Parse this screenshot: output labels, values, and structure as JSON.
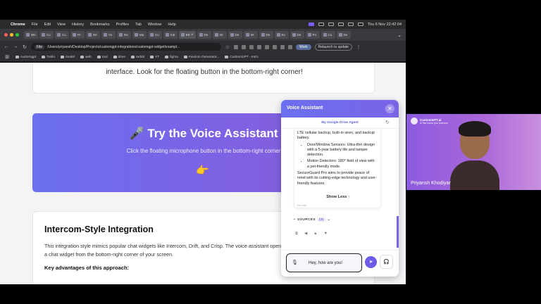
{
  "menubar": {
    "app_name": "Chrome",
    "menus": [
      "File",
      "Edit",
      "View",
      "History",
      "Bookmarks",
      "Profiles",
      "Tab",
      "Window",
      "Help"
    ],
    "clock": "Thu 6 Nov  22:42:04"
  },
  "tabs": [
    "Wo",
    "Co",
    "Cu",
    "Pr",
    "De",
    "Vo",
    "De",
    "Ma",
    "Cu",
    "Inb",
    "Int",
    "De",
    "Int",
    "De",
    "Int",
    "De",
    "Ex",
    "De",
    "Po",
    "Cu",
    "De"
  ],
  "addressbar": {
    "chip": "File",
    "url": "/Users/priyansh/Desktop/Projects/customgpt-integrations/customgpt-widget/exampl...",
    "work_label": "Work",
    "relaunch_label": "Relaunch to update"
  },
  "bookmarks": [
    "customgpt",
    "Trello",
    "model",
    "web",
    "tool",
    "drive",
    "reddit",
    "YT",
    "figma",
    "Favicon Generator...",
    "CustomGPT - Intro"
  ],
  "page": {
    "top_card_text": "interface. Look for the floating button in the bottom-right corner!",
    "hero_title": "🎤 Try the Voice Assistant",
    "hero_subtitle": "Click the floating microphone button in the bottom-right corner",
    "hero_hand": "👉",
    "integration_title": "Intercom-Style Integration",
    "integration_body": "This integration style mimics popular chat widgets like Intercom, Drift, and Crisp. The voice assistant opens a chat widget from the bottom-right corner of your screen.",
    "advantages_label": "Key advantages of this approach:"
  },
  "voice_widget": {
    "title": "Voice Assistant",
    "close_icon": "✕",
    "agent_name": "My Google Drive Agent",
    "message_intro": "LTE cellular backup, built-in siren, and backup battery.",
    "bullets": [
      "Door/Window Sensors: Ultra-thin design with a 5-year battery life and tamper detection.",
      "Motion Detectors: 180° field of view with a pet-friendly mode."
    ],
    "message_outro": "SecureGuard Pro aims to provide peace of mind with its cutting-edge technology and user-friendly features.",
    "show_less_label": "Show Less ↑",
    "timestamp": "Just now",
    "sources_label": "SOURCES",
    "sources_count": "(3)",
    "input_value": "Hey, how are you!"
  },
  "camera": {
    "logo_text": "CustomGPT.ai",
    "logo_sub": "AI that knows your business",
    "person_name": "Priyansh Khodiyar"
  },
  "colors": {
    "accent": "#6b6ff0",
    "accent_purple": "#7a64e6",
    "send_button": "#6b5ce6"
  }
}
